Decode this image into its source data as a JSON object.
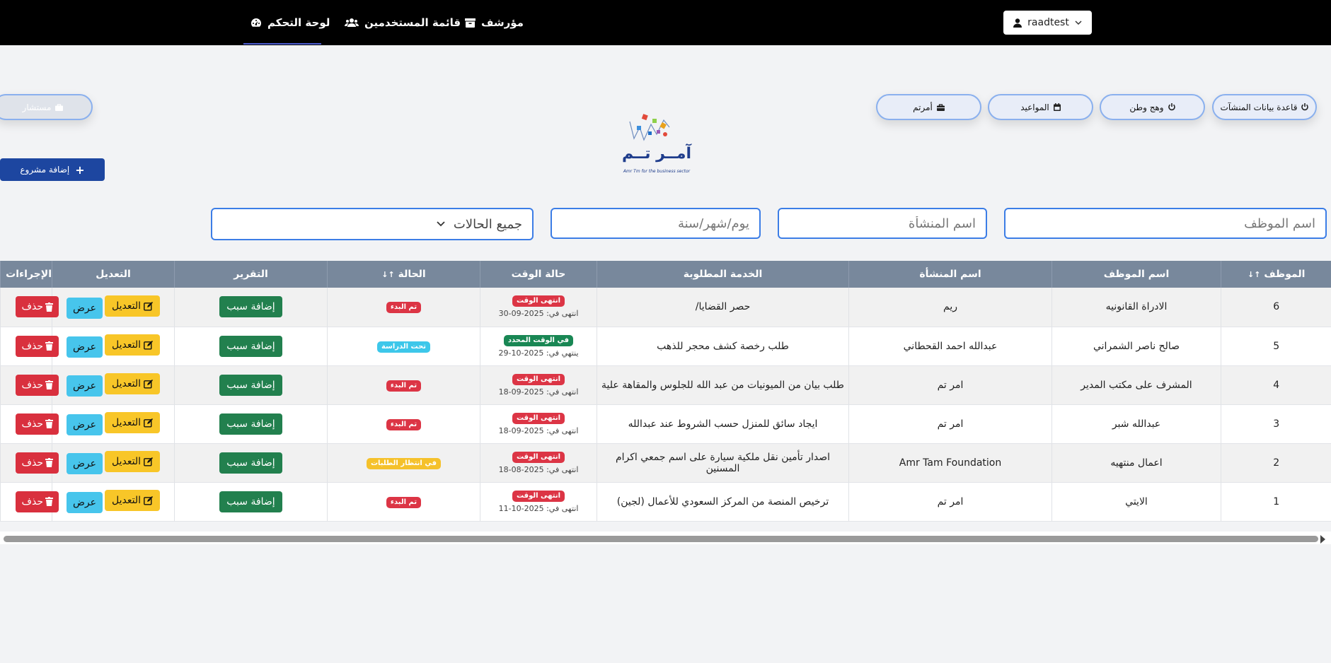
{
  "nav": {
    "dashboard": "لوحة التحكم",
    "users": "قائمة المستخدمين",
    "archive": "مؤرشف",
    "user": "raadtest"
  },
  "pills": {
    "db": "قاعدة بيانات المنشآت",
    "watan": "وهج وطن",
    "appointments": "المواعيد",
    "amrtam": "أمرتم",
    "consultant": "مستشار"
  },
  "add_project": "إضافة مشروع",
  "logo": {
    "name": "آمــر تــم",
    "sub": "Amr Tm for the business sector"
  },
  "filters": {
    "employee": "اسم الموظف",
    "facility": "اسم المنشأة",
    "date": "يوم/شهر/سنة",
    "status": "جميع الحالات"
  },
  "table": {
    "headers": [
      "الموظف",
      "اسم الموظف",
      "اسم المنشأة",
      "الخدمة المطلوبة",
      "حالة الوقت",
      "الحالة",
      "التقرير",
      "التعديل",
      "الإجراءات"
    ],
    "reason_label": "إضافة سبب",
    "view_label": "عرض",
    "edit_label": "التعديل",
    "delete_label": "حذف",
    "rows": [
      {
        "id": "6",
        "employee": "الادراة القانونيه",
        "facility": "ريم",
        "service": "حصر القضايا/",
        "time_badge": "انتهى الوقت",
        "time_color": "#dc3545",
        "expiry": "انتهى في: 2025-09-30",
        "status": "تم البدء",
        "status_color": "#dc3545"
      },
      {
        "id": "5",
        "employee": "صالح ناصر الشمراني",
        "facility": "عبدالله احمد القحطاني",
        "service": "طلب رخصة كشف محجر للذهب",
        "time_badge": "في الوقت المحدد",
        "time_color": "#198754",
        "expiry": "ينتهي في: 2025-10-29",
        "status": "تحت الدراسة",
        "status_color": "#3dc7ea"
      },
      {
        "id": "4",
        "employee": "المشرف على مكتب المدير",
        "facility": "امر تم",
        "service": "طلب بيان من الميونيات من عبد الله للجلوس والمقاهة علية",
        "time_badge": "انتهى الوقت",
        "time_color": "#dc3545",
        "expiry": "انتهى في: 2025-09-18",
        "status": "تم البدء",
        "status_color": "#dc3545"
      },
      {
        "id": "3",
        "employee": "عبدالله شبر",
        "facility": "امر تم",
        "service": "ايجاد سائق للمنزل حسب الشروط عند عبدالله",
        "time_badge": "انتهى الوقت",
        "time_color": "#dc3545",
        "expiry": "انتهى في: 2025-09-18",
        "status": "تم البدء",
        "status_color": "#dc3545"
      },
      {
        "id": "2",
        "employee": "اعمال منتهيه",
        "facility": "Amr Tam Foundation",
        "service": "اصدار تأمين نقل ملكية سيارة على اسم جمعي اكرام المسنين",
        "time_badge": "انتهى الوقت",
        "time_color": "#dc3545",
        "expiry": "انتهى في: 2025-08-18",
        "status": "في انتظار الطلبات",
        "status_color": "#f5c12b"
      },
      {
        "id": "1",
        "employee": "الايتي",
        "facility": "امر تم",
        "service": "ترخيص المنصة من المركز السعودي للأعمال (لجين)",
        "time_badge": "انتهى الوقت",
        "time_color": "#dc3545",
        "expiry": "انتهى في: 2025-10-11",
        "status": "تم البدء",
        "status_color": "#dc3545"
      }
    ]
  }
}
